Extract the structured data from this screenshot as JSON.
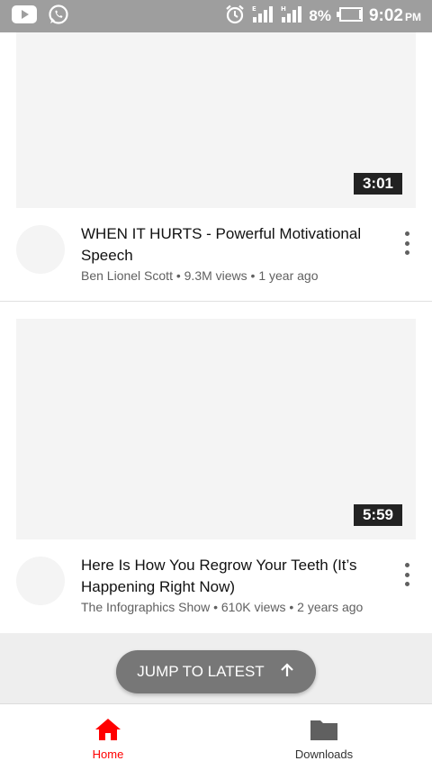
{
  "status_bar": {
    "battery": "8%",
    "time": "9:02",
    "ampm": "PM"
  },
  "videos": [
    {
      "duration": "3:01",
      "title": "WHEN IT HURTS - Powerful Motivational Speech",
      "meta": "Ben Lionel Scott • 9.3M views • 1 year ago"
    },
    {
      "duration": "5:59",
      "title": "Here Is How You Regrow Your Teeth (It’s Happening Right Now)",
      "meta": "The Infographics Show • 610K views • 2 years ago"
    }
  ],
  "jump_button": {
    "label": "JUMP TO LATEST"
  },
  "bottom_nav": {
    "home_label": "Home",
    "downloads_label": "Downloads"
  },
  "colors": {
    "status_bar": "#9e9e9e",
    "active_nav": "#ff0000",
    "inactive_nav": "#606060",
    "jump_button": "#777777"
  }
}
